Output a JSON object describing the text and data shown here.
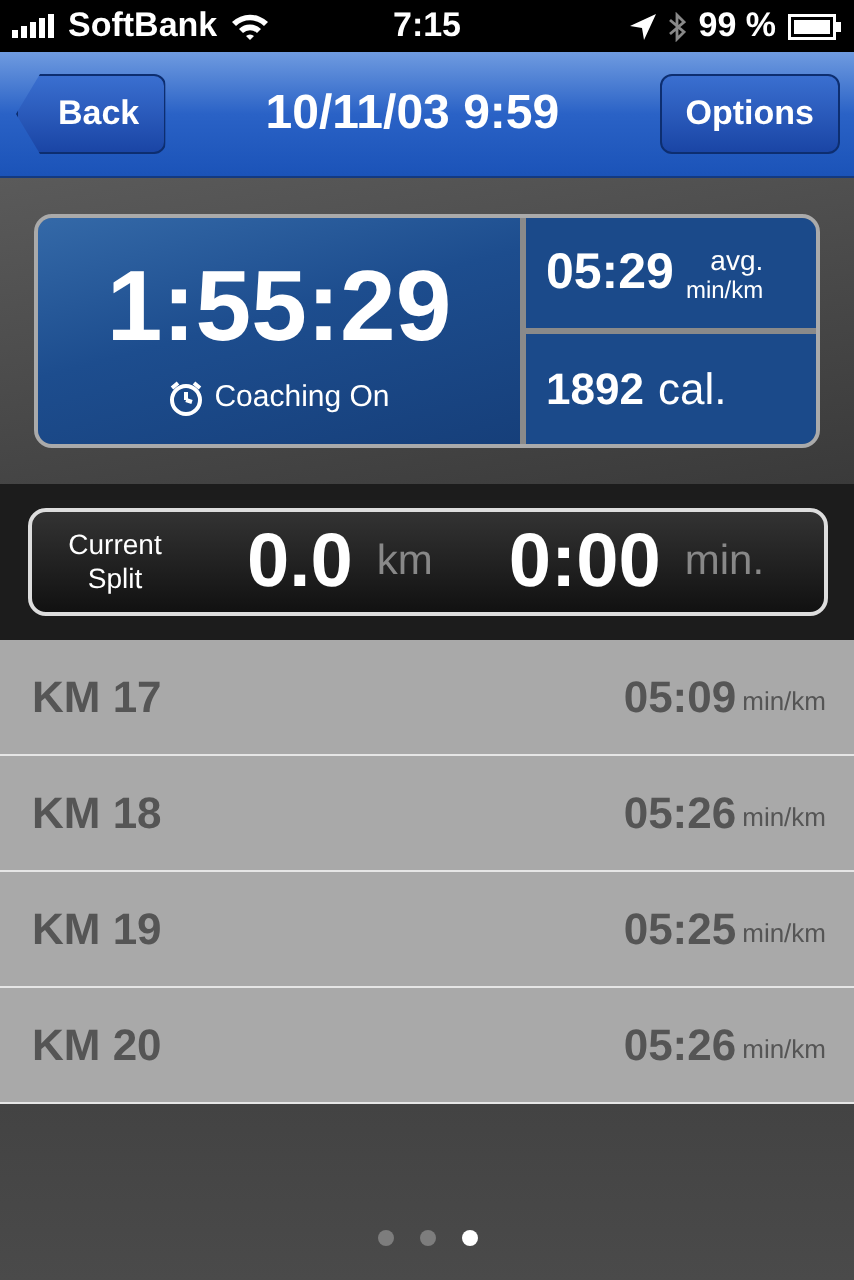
{
  "status_bar": {
    "carrier": "SoftBank",
    "time": "7:15",
    "battery": "99 %"
  },
  "nav": {
    "back": "Back",
    "title": "10/11/03 9:59",
    "options": "Options"
  },
  "dashboard": {
    "duration": "1:55:29",
    "coaching": "Coaching On",
    "pace": "05:29",
    "pace_label": "avg.",
    "pace_unit": "min/km",
    "calories": "1892",
    "calories_unit": "cal."
  },
  "split": {
    "label": "Current Split",
    "distance": "0.0",
    "distance_unit": "km",
    "time": "0:00",
    "time_unit": "min."
  },
  "splits": [
    {
      "label": "KM 17",
      "pace": "05:09",
      "unit": "min/km"
    },
    {
      "label": "KM 18",
      "pace": "05:26",
      "unit": "min/km"
    },
    {
      "label": "KM 19",
      "pace": "05:25",
      "unit": "min/km"
    },
    {
      "label": "KM 20",
      "pace": "05:26",
      "unit": "min/km"
    }
  ],
  "pages": [
    {
      "selected": false
    },
    {
      "selected": false
    },
    {
      "selected": true
    }
  ]
}
